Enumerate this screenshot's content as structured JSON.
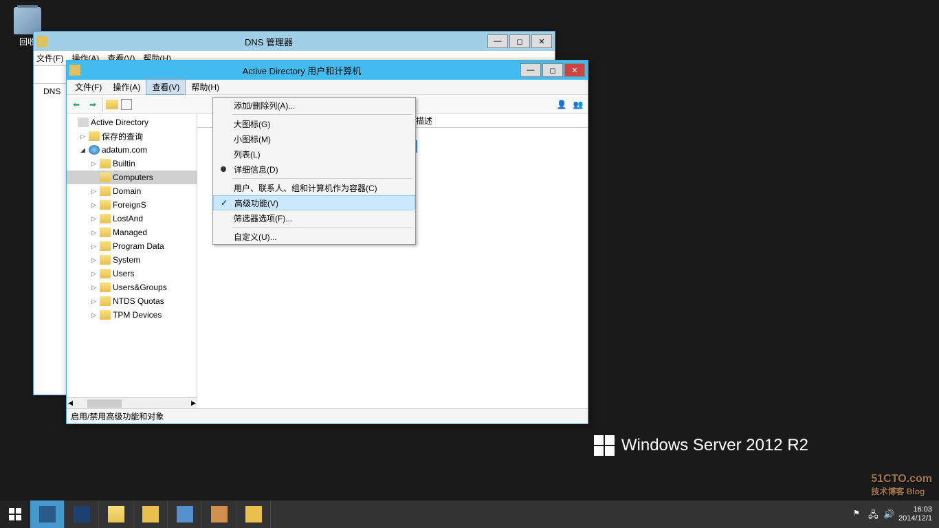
{
  "desktop": {
    "recycle_bin": "回收"
  },
  "window_back": {
    "title": "DNS 管理器",
    "menubar": [
      "文件(F)",
      "操作(A)",
      "查看(V)",
      "帮助(H)"
    ],
    "tree": [
      "DNS"
    ]
  },
  "window_front": {
    "title": "Active Directory 用户和计算机",
    "menubar": {
      "file": "文件(F)",
      "action": "操作(A)",
      "view": "查看(V)",
      "help": "帮助(H)"
    },
    "status": "启用/禁用高级功能和对象",
    "tree": [
      {
        "label": "Active Directory",
        "level": 0,
        "arrow": "",
        "icon": "ad"
      },
      {
        "label": "保存的查询",
        "level": 1,
        "arrow": "▷",
        "icon": "folder"
      },
      {
        "label": "adatum.com",
        "level": 1,
        "arrow": "◢",
        "icon": "globe"
      },
      {
        "label": "Builtin",
        "level": 2,
        "arrow": "▷",
        "icon": "folder"
      },
      {
        "label": "Computers",
        "level": 2,
        "arrow": "",
        "icon": "folder",
        "selected": true
      },
      {
        "label": "Domain",
        "level": 2,
        "arrow": "▷",
        "icon": "folder"
      },
      {
        "label": "ForeignS",
        "level": 2,
        "arrow": "▷",
        "icon": "folder"
      },
      {
        "label": "LostAnd",
        "level": 2,
        "arrow": "▷",
        "icon": "folder"
      },
      {
        "label": "Managed",
        "level": 2,
        "arrow": "▷",
        "icon": "folder"
      },
      {
        "label": "Program Data",
        "level": 2,
        "arrow": "▷",
        "icon": "folder"
      },
      {
        "label": "System",
        "level": 2,
        "arrow": "▷",
        "icon": "folder"
      },
      {
        "label": "Users",
        "level": 2,
        "arrow": "▷",
        "icon": "folder"
      },
      {
        "label": "Users&Groups",
        "level": 2,
        "arrow": "▷",
        "icon": "folder"
      },
      {
        "label": "NTDS Quotas",
        "level": 2,
        "arrow": "▷",
        "icon": "folder"
      },
      {
        "label": "TPM Devices",
        "level": 2,
        "arrow": "▷",
        "icon": "folder"
      }
    ],
    "list": {
      "header_desc": "描述"
    }
  },
  "view_menu": {
    "add_remove_cols": "添加/删除列(A)...",
    "large_icons": "大图标(G)",
    "small_icons": "小图标(M)",
    "list": "列表(L)",
    "details": "详细信息(D)",
    "users_contacts": "用户、联系人、组和计算机作为容器(C)",
    "advanced_features": "高级功能(V)",
    "filter_options": "筛选器选项(F)...",
    "customize": "自定义(U)..."
  },
  "branding": "Windows Server 2012 R2",
  "watermark": {
    "line1": "51CTO.com",
    "line2": "技术博客 Blog"
  },
  "taskbar": {
    "time": "16:03",
    "date": "2014/12/1"
  }
}
